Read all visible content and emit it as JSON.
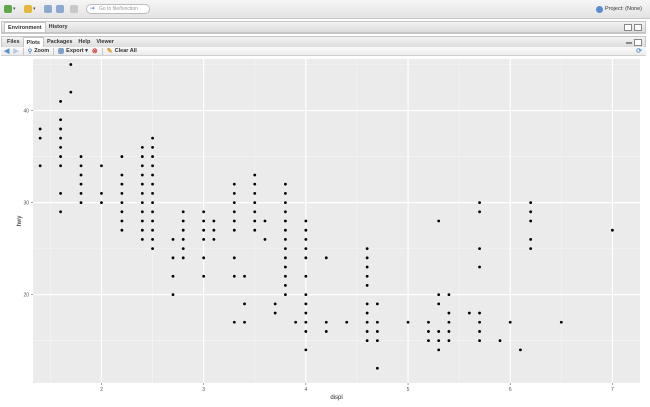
{
  "toolbar": {
    "goto_placeholder": "Go to file/function",
    "project_label": "Project: (None)"
  },
  "env_pane": {
    "tabs": [
      "Environment",
      "History"
    ]
  },
  "files_pane": {
    "tabs": [
      "Files",
      "Plots",
      "Packages",
      "Help",
      "Viewer"
    ],
    "active_tab": "Plots",
    "tools": {
      "zoom": "Zoom",
      "export": "Export ▾",
      "clear": "Clear All"
    }
  },
  "chart_data": {
    "type": "scatter",
    "xlabel": "displ",
    "ylabel": "hwy",
    "xlim": [
      1.33,
      7.27
    ],
    "ylim": [
      10.4,
      45.6
    ],
    "x_ticks": [
      2,
      3,
      4,
      5,
      6,
      7
    ],
    "y_ticks": [
      20,
      30,
      40
    ],
    "grid": true,
    "points": [
      [
        1.4,
        38
      ],
      [
        1.4,
        37
      ],
      [
        1.4,
        34
      ],
      [
        1.6,
        29
      ],
      [
        1.6,
        31
      ],
      [
        1.6,
        34
      ],
      [
        1.6,
        35
      ],
      [
        1.6,
        36
      ],
      [
        1.6,
        37
      ],
      [
        1.6,
        38
      ],
      [
        1.6,
        39
      ],
      [
        1.6,
        41
      ],
      [
        1.7,
        45
      ],
      [
        1.7,
        42
      ],
      [
        1.8,
        30
      ],
      [
        1.8,
        31
      ],
      [
        1.8,
        32
      ],
      [
        1.8,
        33
      ],
      [
        1.8,
        34
      ],
      [
        1.8,
        35
      ],
      [
        2.0,
        30
      ],
      [
        2.0,
        31
      ],
      [
        2.0,
        34
      ],
      [
        2.2,
        27
      ],
      [
        2.2,
        28
      ],
      [
        2.2,
        29
      ],
      [
        2.2,
        30
      ],
      [
        2.2,
        31
      ],
      [
        2.2,
        32
      ],
      [
        2.2,
        33
      ],
      [
        2.2,
        35
      ],
      [
        2.4,
        26
      ],
      [
        2.4,
        27
      ],
      [
        2.4,
        28
      ],
      [
        2.4,
        29
      ],
      [
        2.4,
        30
      ],
      [
        2.4,
        31
      ],
      [
        2.4,
        32
      ],
      [
        2.4,
        33
      ],
      [
        2.4,
        34
      ],
      [
        2.4,
        35
      ],
      [
        2.4,
        36
      ],
      [
        2.5,
        25
      ],
      [
        2.5,
        26
      ],
      [
        2.5,
        27
      ],
      [
        2.5,
        28
      ],
      [
        2.5,
        29
      ],
      [
        2.5,
        30
      ],
      [
        2.5,
        31
      ],
      [
        2.5,
        32
      ],
      [
        2.5,
        33
      ],
      [
        2.5,
        34
      ],
      [
        2.5,
        35
      ],
      [
        2.5,
        36
      ],
      [
        2.5,
        37
      ],
      [
        2.7,
        20
      ],
      [
        2.7,
        22
      ],
      [
        2.7,
        24
      ],
      [
        2.7,
        26
      ],
      [
        2.8,
        24
      ],
      [
        2.8,
        25
      ],
      [
        2.8,
        26
      ],
      [
        2.8,
        27
      ],
      [
        2.8,
        28
      ],
      [
        2.8,
        29
      ],
      [
        3.0,
        22
      ],
      [
        3.0,
        24
      ],
      [
        3.0,
        26
      ],
      [
        3.0,
        27
      ],
      [
        3.0,
        28
      ],
      [
        3.0,
        29
      ],
      [
        3.1,
        26
      ],
      [
        3.1,
        27
      ],
      [
        3.1,
        28
      ],
      [
        3.3,
        17
      ],
      [
        3.3,
        22
      ],
      [
        3.3,
        24
      ],
      [
        3.3,
        27
      ],
      [
        3.3,
        28
      ],
      [
        3.3,
        29
      ],
      [
        3.3,
        30
      ],
      [
        3.3,
        31
      ],
      [
        3.3,
        32
      ],
      [
        3.4,
        17
      ],
      [
        3.4,
        19
      ],
      [
        3.4,
        22
      ],
      [
        3.5,
        27
      ],
      [
        3.5,
        28
      ],
      [
        3.5,
        29
      ],
      [
        3.5,
        30
      ],
      [
        3.5,
        31
      ],
      [
        3.5,
        32
      ],
      [
        3.5,
        33
      ],
      [
        3.6,
        26
      ],
      [
        3.6,
        28
      ],
      [
        3.7,
        18
      ],
      [
        3.7,
        19
      ],
      [
        3.8,
        20
      ],
      [
        3.8,
        21
      ],
      [
        3.8,
        22
      ],
      [
        3.8,
        23
      ],
      [
        3.8,
        24
      ],
      [
        3.8,
        25
      ],
      [
        3.8,
        26
      ],
      [
        3.8,
        27
      ],
      [
        3.8,
        28
      ],
      [
        3.8,
        29
      ],
      [
        3.8,
        30
      ],
      [
        3.8,
        31
      ],
      [
        3.8,
        32
      ],
      [
        3.9,
        17
      ],
      [
        4.0,
        14
      ],
      [
        4.0,
        16
      ],
      [
        4.0,
        17
      ],
      [
        4.0,
        18
      ],
      [
        4.0,
        19
      ],
      [
        4.0,
        20
      ],
      [
        4.0,
        22
      ],
      [
        4.0,
        24
      ],
      [
        4.0,
        25
      ],
      [
        4.0,
        26
      ],
      [
        4.0,
        27
      ],
      [
        4.0,
        28
      ],
      [
        4.2,
        16
      ],
      [
        4.2,
        17
      ],
      [
        4.2,
        24
      ],
      [
        4.4,
        17
      ],
      [
        4.6,
        15
      ],
      [
        4.6,
        16
      ],
      [
        4.6,
        17
      ],
      [
        4.6,
        18
      ],
      [
        4.6,
        19
      ],
      [
        4.6,
        21
      ],
      [
        4.6,
        22
      ],
      [
        4.6,
        23
      ],
      [
        4.6,
        24
      ],
      [
        4.6,
        25
      ],
      [
        4.7,
        12
      ],
      [
        4.7,
        15
      ],
      [
        4.7,
        16
      ],
      [
        4.7,
        17
      ],
      [
        4.7,
        19
      ],
      [
        5.0,
        17
      ],
      [
        5.2,
        15
      ],
      [
        5.2,
        16
      ],
      [
        5.2,
        17
      ],
      [
        5.3,
        14
      ],
      [
        5.3,
        15
      ],
      [
        5.3,
        16
      ],
      [
        5.3,
        19
      ],
      [
        5.3,
        20
      ],
      [
        5.3,
        28
      ],
      [
        5.4,
        15
      ],
      [
        5.4,
        16
      ],
      [
        5.4,
        17
      ],
      [
        5.4,
        18
      ],
      [
        5.4,
        20
      ],
      [
        5.6,
        18
      ],
      [
        5.7,
        15
      ],
      [
        5.7,
        16
      ],
      [
        5.7,
        17
      ],
      [
        5.7,
        18
      ],
      [
        5.7,
        23
      ],
      [
        5.7,
        25
      ],
      [
        5.7,
        29
      ],
      [
        5.7,
        30
      ],
      [
        5.9,
        15
      ],
      [
        6.0,
        17
      ],
      [
        6.1,
        14
      ],
      [
        6.2,
        25
      ],
      [
        6.2,
        26
      ],
      [
        6.2,
        28
      ],
      [
        6.2,
        29
      ],
      [
        6.2,
        30
      ],
      [
        6.5,
        17
      ],
      [
        7.0,
        27
      ]
    ]
  }
}
